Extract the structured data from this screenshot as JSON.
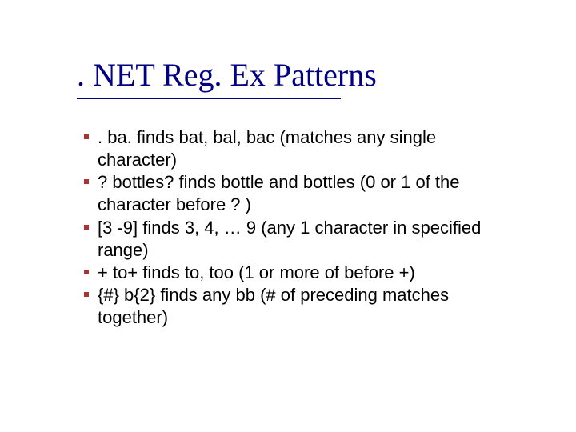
{
  "title": ". NET Reg. Ex Patterns",
  "items": [
    ".  ba. finds bat, bal, bac (matches any single character)",
    "?  bottles? finds bottle and bottles (0 or 1 of the character before ? )",
    "[3 -9]  finds 3, 4, … 9 (any 1 character in specified range)",
    "+  to+ finds to, too (1 or more of before +)",
    "{#}  b{2} finds any bb (# of preceding matches together)"
  ]
}
